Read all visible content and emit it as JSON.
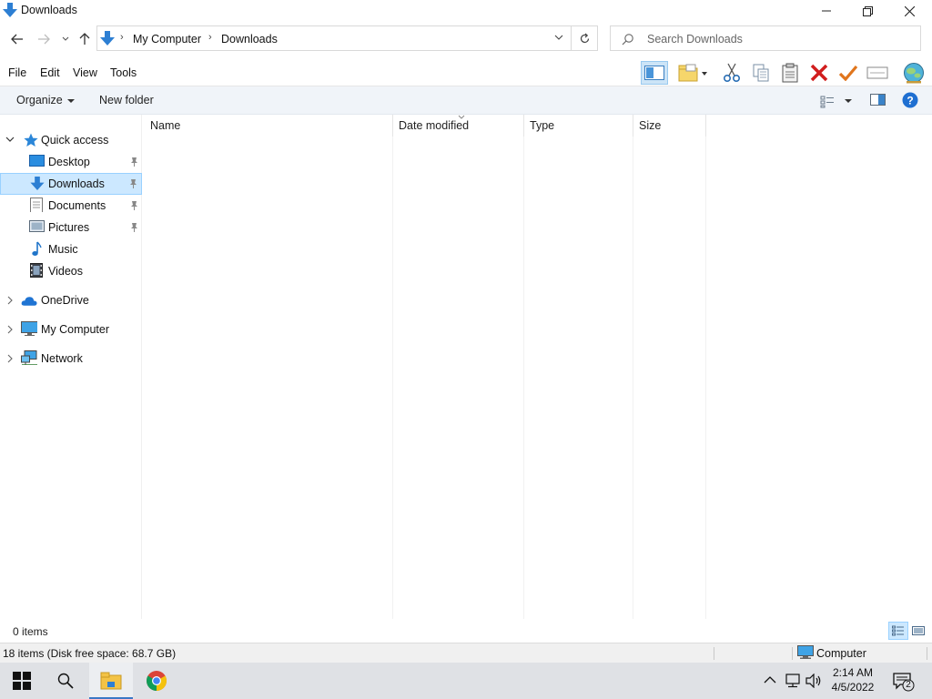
{
  "window": {
    "title": "Downloads",
    "controls": {
      "minimize": "minimize",
      "restore": "restore",
      "close": "close"
    }
  },
  "address": {
    "breadcrumbs": [
      "My Computer",
      "Downloads"
    ],
    "search_placeholder": "Search Downloads"
  },
  "menu": {
    "items": [
      "File",
      "Edit",
      "View",
      "Tools"
    ]
  },
  "toolbar_icons": [
    "preview-pane-icon",
    "new-folder-icon",
    "cut-icon",
    "copy-icon",
    "paste-icon",
    "delete-icon",
    "checkmark-icon",
    "rename-icon",
    "globe-icon"
  ],
  "commandbar": {
    "organize": "Organize",
    "new_folder": "New folder"
  },
  "navpane": {
    "quick_access": "Quick access",
    "quick_items": [
      {
        "label": "Desktop",
        "icon": "desktop-icon",
        "pinned": true
      },
      {
        "label": "Downloads",
        "icon": "downloads-icon",
        "pinned": true,
        "selected": true
      },
      {
        "label": "Documents",
        "icon": "documents-icon",
        "pinned": true
      },
      {
        "label": "Pictures",
        "icon": "pictures-icon",
        "pinned": true
      },
      {
        "label": "Music",
        "icon": "music-icon",
        "pinned": false
      },
      {
        "label": "Videos",
        "icon": "videos-icon",
        "pinned": false
      }
    ],
    "roots": [
      {
        "label": "OneDrive",
        "icon": "onedrive-icon"
      },
      {
        "label": "My Computer",
        "icon": "computer-icon"
      },
      {
        "label": "Network",
        "icon": "network-icon"
      }
    ]
  },
  "columns": [
    "Name",
    "Date modified",
    "Type",
    "Size"
  ],
  "status": {
    "items_count": "0 items",
    "disk_info": "18 items (Disk free space: 68.7 GB)",
    "zone": "Computer"
  },
  "taskbar": {
    "time": "2:14 AM",
    "date": "4/5/2022",
    "notification_count": "2"
  },
  "colors": {
    "accent": "#0078d7",
    "selection": "#cce8ff",
    "taskbar": "#dfe1e5",
    "help": "#1f6fd1"
  }
}
